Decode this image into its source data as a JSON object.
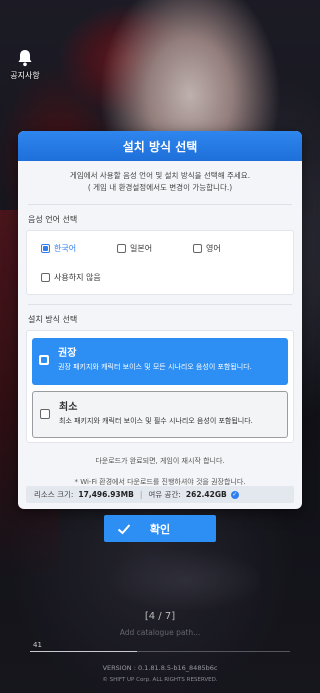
{
  "notice": {
    "label": "공지사항",
    "icon": "bell-icon"
  },
  "dialog": {
    "title": "설치 방식 선택",
    "intro_line1": "게임에서 사용할 음성 언어 및 설치 방식을 선택해 주세요.",
    "intro_line2": "( 게임 내 환경설정에서도 변경이 가능합니다.)",
    "voice_section": {
      "title": "음성 언어 선택",
      "options": [
        {
          "label": "한국어",
          "checked": true
        },
        {
          "label": "일본어",
          "checked": false
        },
        {
          "label": "영어",
          "checked": false
        },
        {
          "label": "사용하지 않음",
          "checked": false
        }
      ]
    },
    "method_section": {
      "title": "설치 방식 선택",
      "options": [
        {
          "title": "권장",
          "desc": "권장 패키지와 캐릭터 보이스 및 모든 시나리오 음성이 포함됩니다.",
          "checked": true
        },
        {
          "title": "최소",
          "desc": "최소 패키지와 캐릭터 보이스 및 필수 시나리오 음성이 포함됩니다.",
          "checked": false
        }
      ]
    },
    "note1": "다운로드가 완료되면, 게임이 재시작 합니다.",
    "note2": "* Wi-Fi 환경에서 다운로드를 진행하셔야 것을 권장합니다.",
    "storage": {
      "resource_label": "리소스 크기:",
      "resource_value": "17,496.93MB",
      "free_label": "여유 공간:",
      "free_value": "262.42GB"
    }
  },
  "confirm_label": "확인",
  "footer": {
    "progress": "[4 / 7]",
    "path": "Add catalogue path...",
    "percent": "41",
    "percent_value": 41,
    "version": "VERSION : 0.1.81.8.5-b16_8485b6c",
    "copyright": "© SHIFT UP Corp. ALL RIGHTS RESERVED."
  },
  "colors": {
    "accent": "#2d8ef4",
    "header": "#1e6fd9"
  }
}
